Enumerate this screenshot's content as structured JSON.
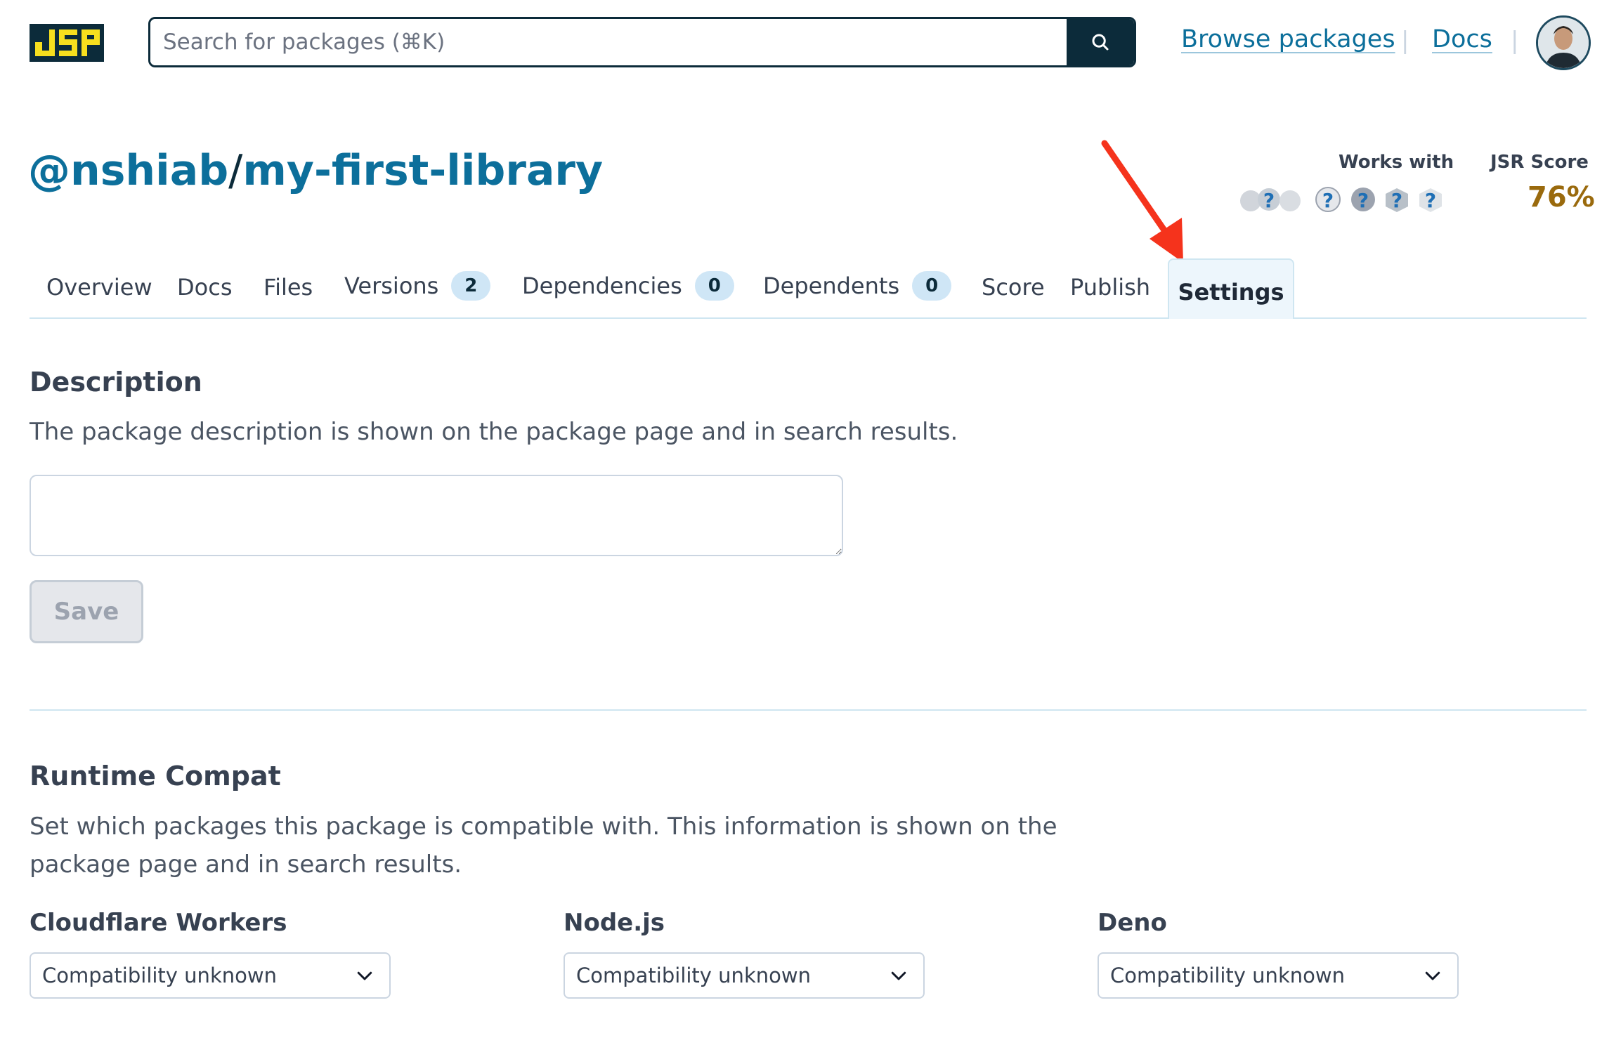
{
  "header": {
    "search_placeholder": "Search for packages (⌘K)",
    "nav": {
      "browse": "Browse packages",
      "docs": "Docs",
      "separator": "|"
    }
  },
  "package": {
    "scope": "@nshiab",
    "slash": "/",
    "name": "my-first-library",
    "works_with_label": "Works with",
    "score_label": "JSR Score",
    "score_value": "76%"
  },
  "tabs": {
    "overview": "Overview",
    "docs": "Docs",
    "files": "Files",
    "versions": "Versions",
    "versions_count": "2",
    "dependencies": "Dependencies",
    "dependencies_count": "0",
    "dependents": "Dependents",
    "dependents_count": "0",
    "score": "Score",
    "publish": "Publish",
    "settings": "Settings"
  },
  "description": {
    "heading": "Description",
    "help": "The package description is shown on the package page and in search results.",
    "value": "",
    "save_label": "Save"
  },
  "runtime_compat": {
    "heading": "Runtime Compat",
    "help_line1": "Set which packages this package is compatible with. This information is shown on the",
    "help_line2": "package page and in search results.",
    "runtimes": [
      {
        "label": "Cloudflare Workers",
        "value": "Compatibility unknown"
      },
      {
        "label": "Node.js",
        "value": "Compatibility unknown"
      },
      {
        "label": "Deno",
        "value": "Compatibility unknown"
      }
    ]
  },
  "colors": {
    "brand_dark": "#0c2b3a",
    "brand_yellow": "#f7df1e",
    "link": "#0c6f9b",
    "score": "#9a6a0d",
    "annotation_arrow": "#f5331c"
  }
}
